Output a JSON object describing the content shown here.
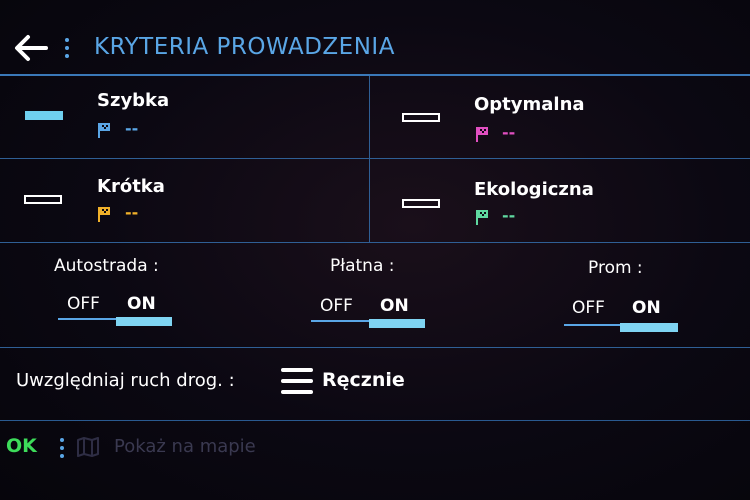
{
  "header": {
    "title": "KRYTERIA PROWADZENIA",
    "back_icon": "arrow-left-icon",
    "menu_icon": "kebab-menu-icon"
  },
  "routes": [
    {
      "name": "Szybka",
      "value": "--",
      "selected": true,
      "flag_color": "#5aa6e6"
    },
    {
      "name": "Optymalna",
      "value": "--",
      "selected": false,
      "flag_color": "#e04fc0"
    },
    {
      "name": "Krótka",
      "value": "--",
      "selected": false,
      "flag_color": "#f0b02a"
    },
    {
      "name": "Ekologiczna",
      "value": "--",
      "selected": false,
      "flag_color": "#5fd8a0"
    }
  ],
  "toggles": [
    {
      "label": "Autostrada :",
      "off": "OFF",
      "on": "ON",
      "state": "on"
    },
    {
      "label": "Płatna :",
      "off": "OFF",
      "on": "ON",
      "state": "on"
    },
    {
      "label": "Prom :",
      "off": "OFF",
      "on": "ON",
      "state": "on"
    }
  ],
  "traffic": {
    "label": "Uwzględniaj ruch drog. :",
    "value": "Ręcznie",
    "icon": "hamburger-menu-icon"
  },
  "bottom": {
    "ok": "OK",
    "map_label": "Pokaż na mapie",
    "map_icon": "map-icon"
  },
  "colors": {
    "accent": "#5aa6e6",
    "ok": "#3ddc5a",
    "selected_bar": "#6fd0ef",
    "disabled_text": "#3a3950"
  }
}
